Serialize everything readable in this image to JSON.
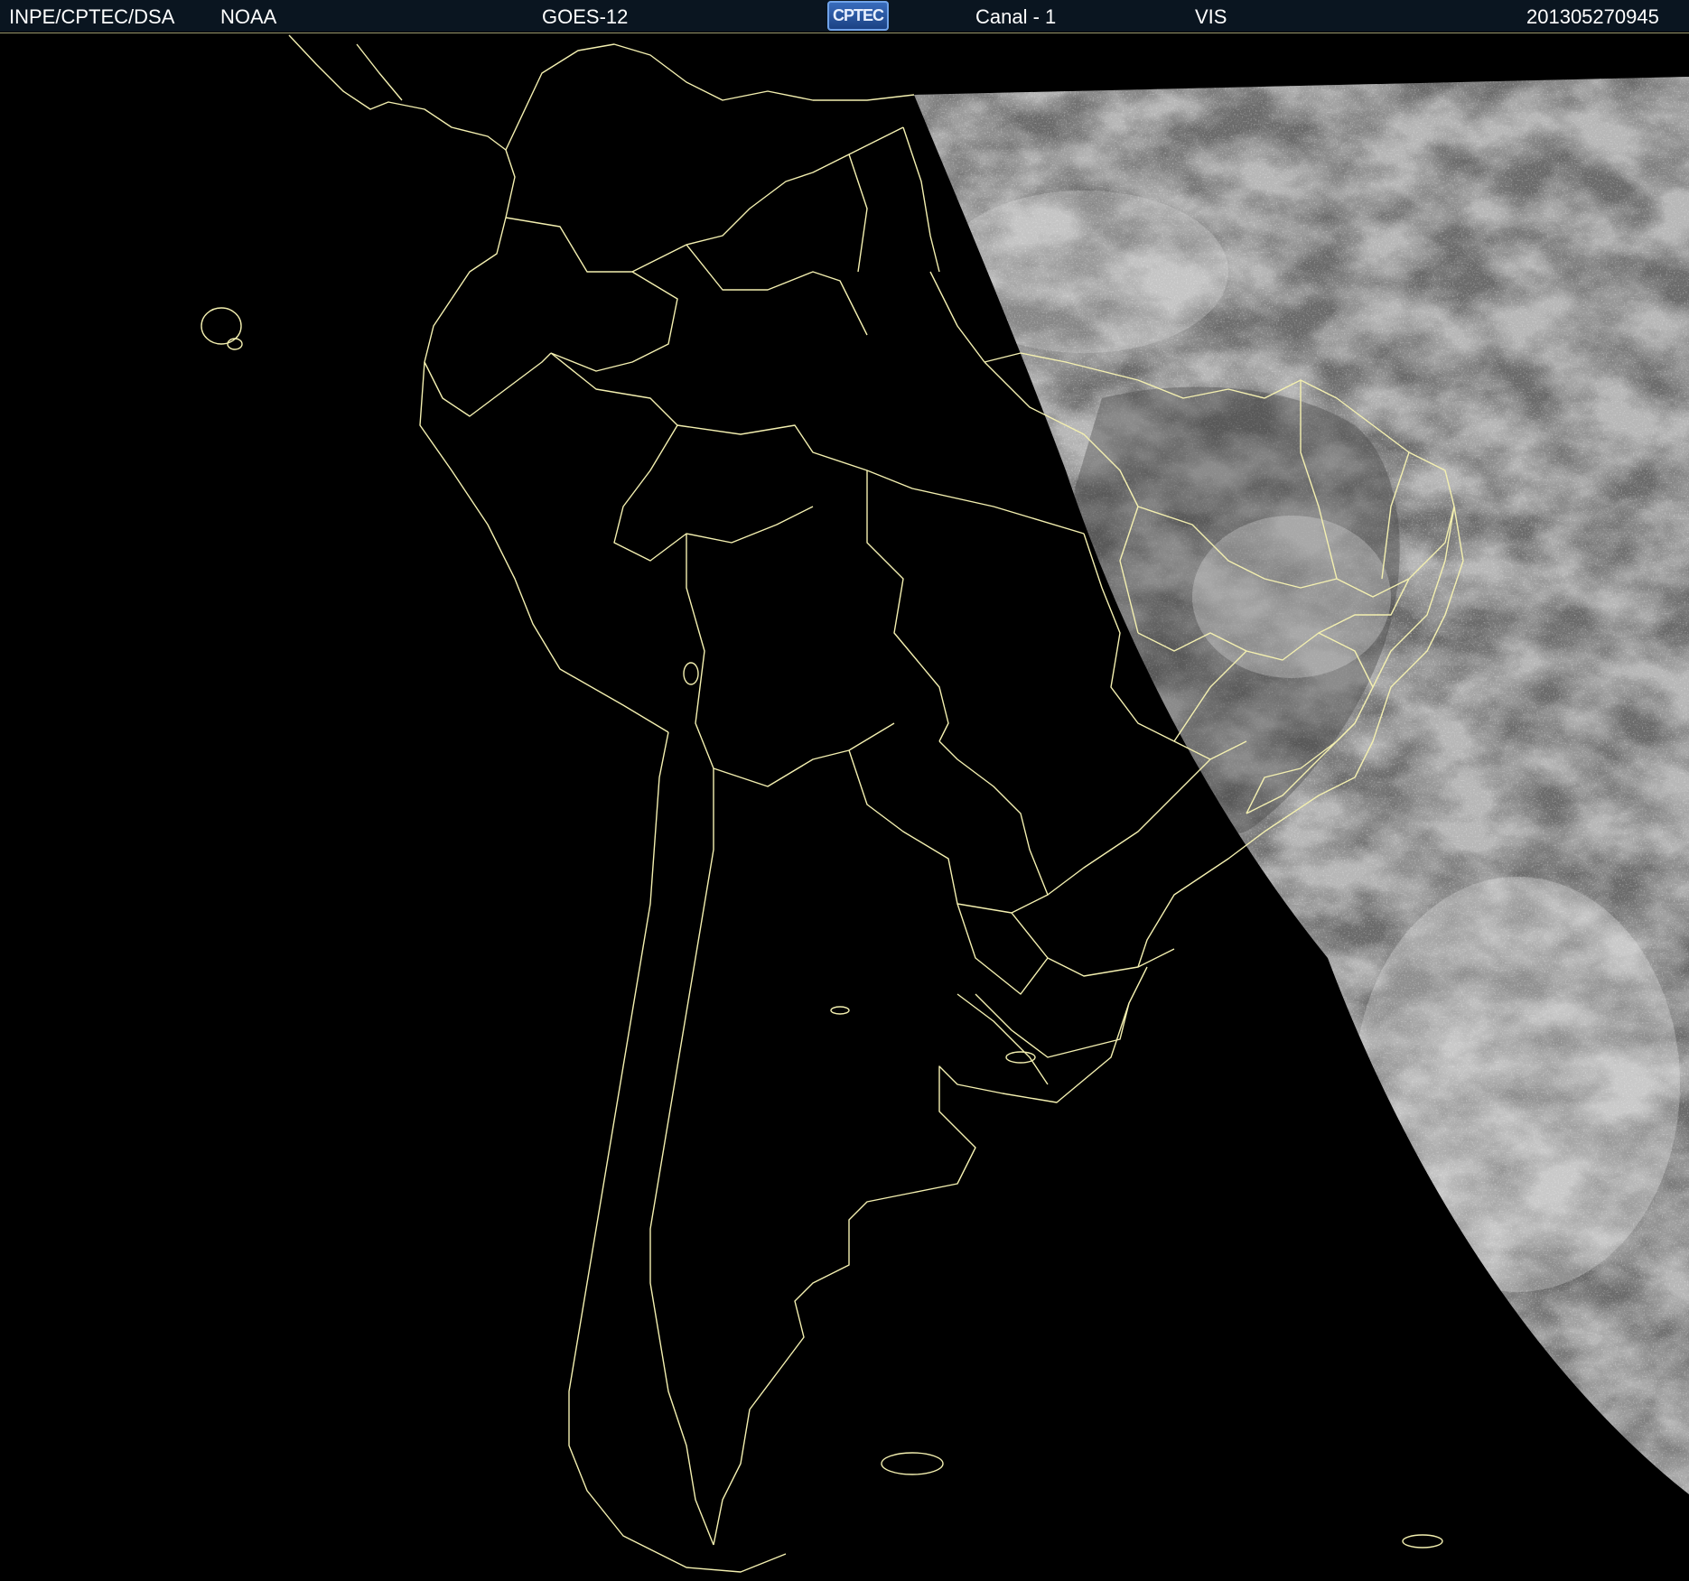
{
  "header": {
    "agency": "INPE/CPTEC/DSA",
    "partner": "NOAA",
    "satellite": "GOES-12",
    "logo_text": "CPTEC",
    "channel": "Canal - 1",
    "band": "VIS",
    "timestamp": "201305270945"
  },
  "map": {
    "region": "South America",
    "boundary_color": "#f4f0b0",
    "background_color": "#000000",
    "cloud_imagery": "visible channel daylight portion on the east",
    "icons": [
      "cptec-logo"
    ]
  }
}
